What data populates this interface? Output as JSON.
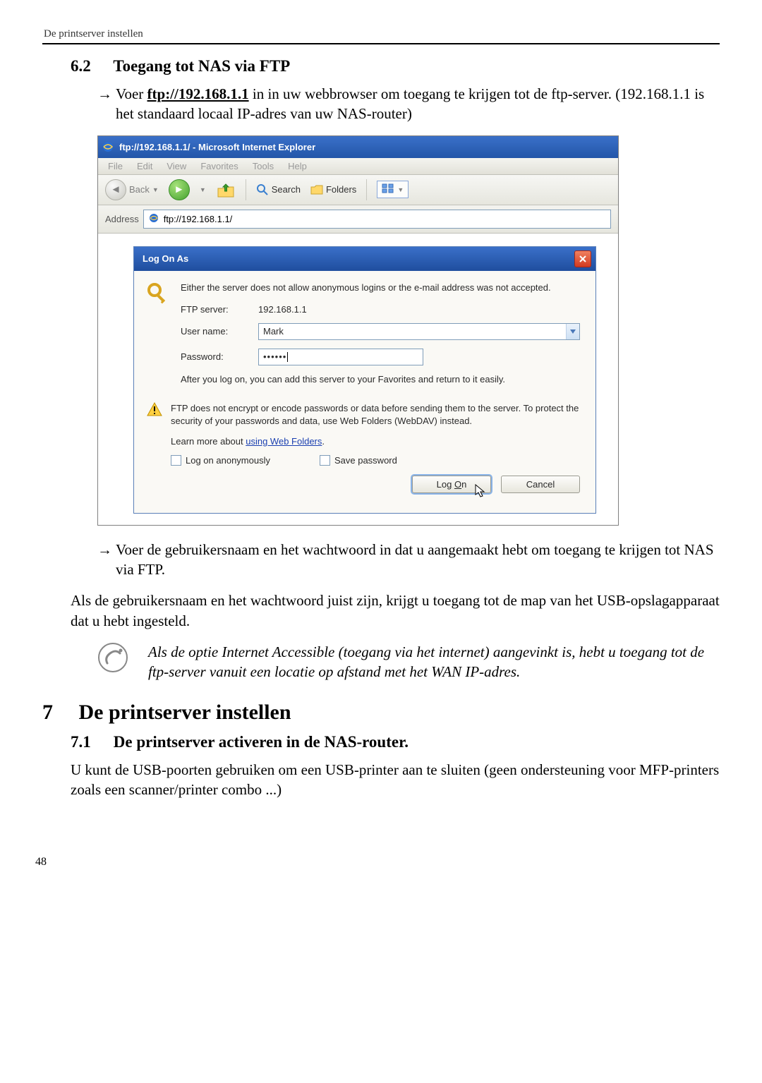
{
  "header": {
    "running": "De printserver instellen"
  },
  "s62": {
    "num": "6.2",
    "title": "Toegang tot NAS via FTP",
    "bullet1_pre": "Voer ",
    "bullet1_link": "ftp://192.168.1.1",
    "bullet1_post": " in in uw webbrowser om toegang te krijgen tot de ftp-server. (192.168.1.1 is het standaard locaal IP-adres van uw NAS-router)"
  },
  "ie": {
    "title": "ftp://192.168.1.1/ - Microsoft Internet Explorer",
    "menu": {
      "file": "File",
      "edit": "Edit",
      "view": "View",
      "favorites": "Favorites",
      "tools": "Tools",
      "help": "Help"
    },
    "toolbar": {
      "back": "Back",
      "search": "Search",
      "folders": "Folders"
    },
    "addressbar": {
      "label": "Address",
      "value": "ftp://192.168.1.1/"
    }
  },
  "dialog": {
    "title": "Log On As",
    "msg1": "Either the server does not allow anonymous logins or the e-mail address was not accepted.",
    "ftp_label": "FTP server:",
    "ftp_value": "192.168.1.1",
    "user_label": "User name:",
    "user_value": "Mark",
    "pass_label": "Password:",
    "pass_value": "••••••",
    "info1": "After you log on, you can add this server to your Favorites and return to it easily.",
    "warn": "FTP does not encrypt or encode passwords or data before sending them to the server.  To protect the security of your passwords and data, use Web Folders (WebDAV) instead.",
    "learn_pre": "Learn more about ",
    "learn_link": "using Web Folders",
    "learn_post": ".",
    "anon": "Log on anonymously",
    "save": "Save password",
    "logon_btn_pre": "Log ",
    "logon_btn_u": "O",
    "logon_btn_post": "n",
    "cancel_btn": "Cancel"
  },
  "after": {
    "bullet2": "Voer de gebruikersnaam en het wachtwoord in dat u aangemaakt hebt om toegang te krijgen tot NAS via FTP.",
    "para": "Als de gebruikersnaam en het wachtwoord juist zijn, krijgt u toegang tot de map van het USB-opslagapparaat dat u hebt ingesteld.",
    "note": "Als de optie Internet Accessible (toegang via het internet) aangevinkt is, hebt u toegang tot de ftp-server vanuit een locatie op afstand met het WAN IP-adres."
  },
  "s7": {
    "num": "7",
    "title": "De printserver instellen",
    "sub_num": "7.1",
    "sub_title": "De printserver activeren in de NAS-router.",
    "para": "U kunt de USB-poorten gebruiken om een USB-printer aan te sluiten (geen ondersteuning voor MFP-printers zoals een scanner/printer combo ...)"
  },
  "page_number": "48"
}
